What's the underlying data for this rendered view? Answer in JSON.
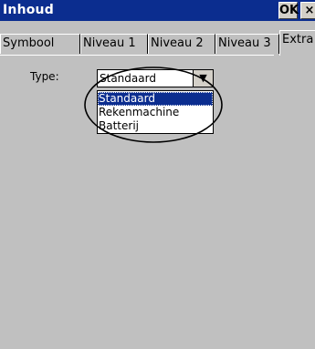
{
  "window": {
    "title": "Inhoud",
    "ok_label": "OK",
    "close_label": "×"
  },
  "tabs": [
    {
      "label": "Symbool"
    },
    {
      "label": "Niveau 1"
    },
    {
      "label": "Niveau 2"
    },
    {
      "label": "Niveau 3"
    },
    {
      "label": "Extra",
      "active": true
    }
  ],
  "form": {
    "type_label": "Type:",
    "type_value": "Standaard",
    "options": [
      "Standaard",
      "Rekenmachine",
      "Batterij"
    ],
    "selected_option": "Standaard"
  },
  "colors": {
    "titlebar": "#0b2d8f",
    "background": "#c0c0c0",
    "selection": "#0b2d8f"
  }
}
